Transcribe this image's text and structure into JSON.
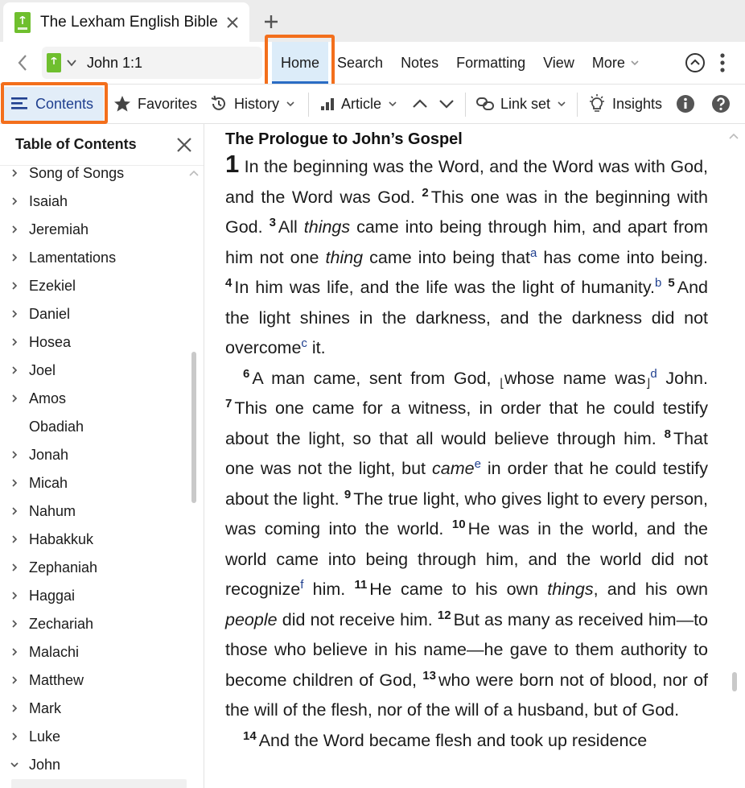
{
  "tab": {
    "title": "The Lexham English Bible"
  },
  "nav": {
    "reference": "John 1:1",
    "menus": [
      {
        "label": "Home",
        "active": true
      },
      {
        "label": "Search"
      },
      {
        "label": "Notes"
      },
      {
        "label": "Formatting"
      },
      {
        "label": "View"
      },
      {
        "label": "More"
      }
    ]
  },
  "toolbar": {
    "contents": "Contents",
    "favorites": "Favorites",
    "history": "History",
    "article": "Article",
    "link_set": "Link set",
    "insights": "Insights"
  },
  "sidebar": {
    "title": "Table of Contents",
    "items": [
      {
        "label": "Song of Songs",
        "chevron": "right"
      },
      {
        "label": "Isaiah",
        "chevron": "right"
      },
      {
        "label": "Jeremiah",
        "chevron": "right"
      },
      {
        "label": "Lamentations",
        "chevron": "right"
      },
      {
        "label": "Ezekiel",
        "chevron": "right"
      },
      {
        "label": "Daniel",
        "chevron": "right"
      },
      {
        "label": "Hosea",
        "chevron": "right"
      },
      {
        "label": "Joel",
        "chevron": "right"
      },
      {
        "label": "Amos",
        "chevron": "right"
      },
      {
        "label": "Obadiah",
        "chevron": "none"
      },
      {
        "label": "Jonah",
        "chevron": "right"
      },
      {
        "label": "Micah",
        "chevron": "right"
      },
      {
        "label": "Nahum",
        "chevron": "right"
      },
      {
        "label": "Habakkuk",
        "chevron": "right"
      },
      {
        "label": "Zephaniah",
        "chevron": "right"
      },
      {
        "label": "Haggai",
        "chevron": "right"
      },
      {
        "label": "Zechariah",
        "chevron": "right"
      },
      {
        "label": "Malachi",
        "chevron": "right"
      },
      {
        "label": "Matthew",
        "chevron": "right"
      },
      {
        "label": "Mark",
        "chevron": "right"
      },
      {
        "label": "Luke",
        "chevron": "right"
      },
      {
        "label": "John",
        "chevron": "down"
      }
    ]
  },
  "passage": {
    "heading": "The Prologue to John’s Gospel",
    "chapter": "1",
    "p1": {
      "t1": "In the beginning was the Word, and the Word was with God, and the Word was God.",
      "v2": "2",
      "t2": "This one was in the beginning with God.",
      "v3": "3",
      "t3a": "All ",
      "t3i": "things",
      "t3b": " came into being through him, and apart from him not one ",
      "t3i2": "thing",
      "t3c": " came into being that",
      "fa": "a",
      "t3d": " has come into being.",
      "v4": "4",
      "t4": "In him was life, and the life was the light of humanity.",
      "fb": "b",
      "v5": "5",
      "t5a": "And the light shines in the darkness, and the darkness did not overcome",
      "fc": "c",
      "t5b": " it."
    },
    "p2": {
      "v6": "6",
      "t6a": "A man came, sent from God, ",
      "lb": "⌊",
      "t6b": "whose name was",
      "rb": "⌋",
      "fd": "d",
      "t6c": " John.",
      "v7": "7",
      "t7": "This one came for a witness, in order that he could testify about the light, so that all would believe through him.",
      "v8": "8",
      "t8a": "That one was not the light, but ",
      "t8i": "came",
      "fe": "e",
      "t8b": " in order that he could testify about the light.",
      "v9": "9",
      "t9": "The true light, who gives light to every person, was coming into the world.",
      "v10": "10",
      "t10a": "He was in the world, and the world came into being through him, and the world did not recognize",
      "ff": "f",
      "t10b": " him.",
      "v11": "11",
      "t11a": "He came to his own ",
      "t11i": "things",
      "t11b": ", and his own ",
      "t11i2": "people",
      "t11c": " did not receive him.",
      "v12": "12",
      "t12": "But as many as received him—to those who believe in his name—he gave to them authority to become children of God,",
      "v13": "13",
      "t13": "who were born not of blood, nor of the will of the flesh, nor of the will of a husband, but of God."
    },
    "p3": {
      "v14": "14",
      "t14": "And the Word became flesh and took up residence"
    }
  },
  "colors": {
    "accent": "#2a6cc4",
    "highlight": "#f36f1c",
    "link": "#1f3f8f"
  }
}
